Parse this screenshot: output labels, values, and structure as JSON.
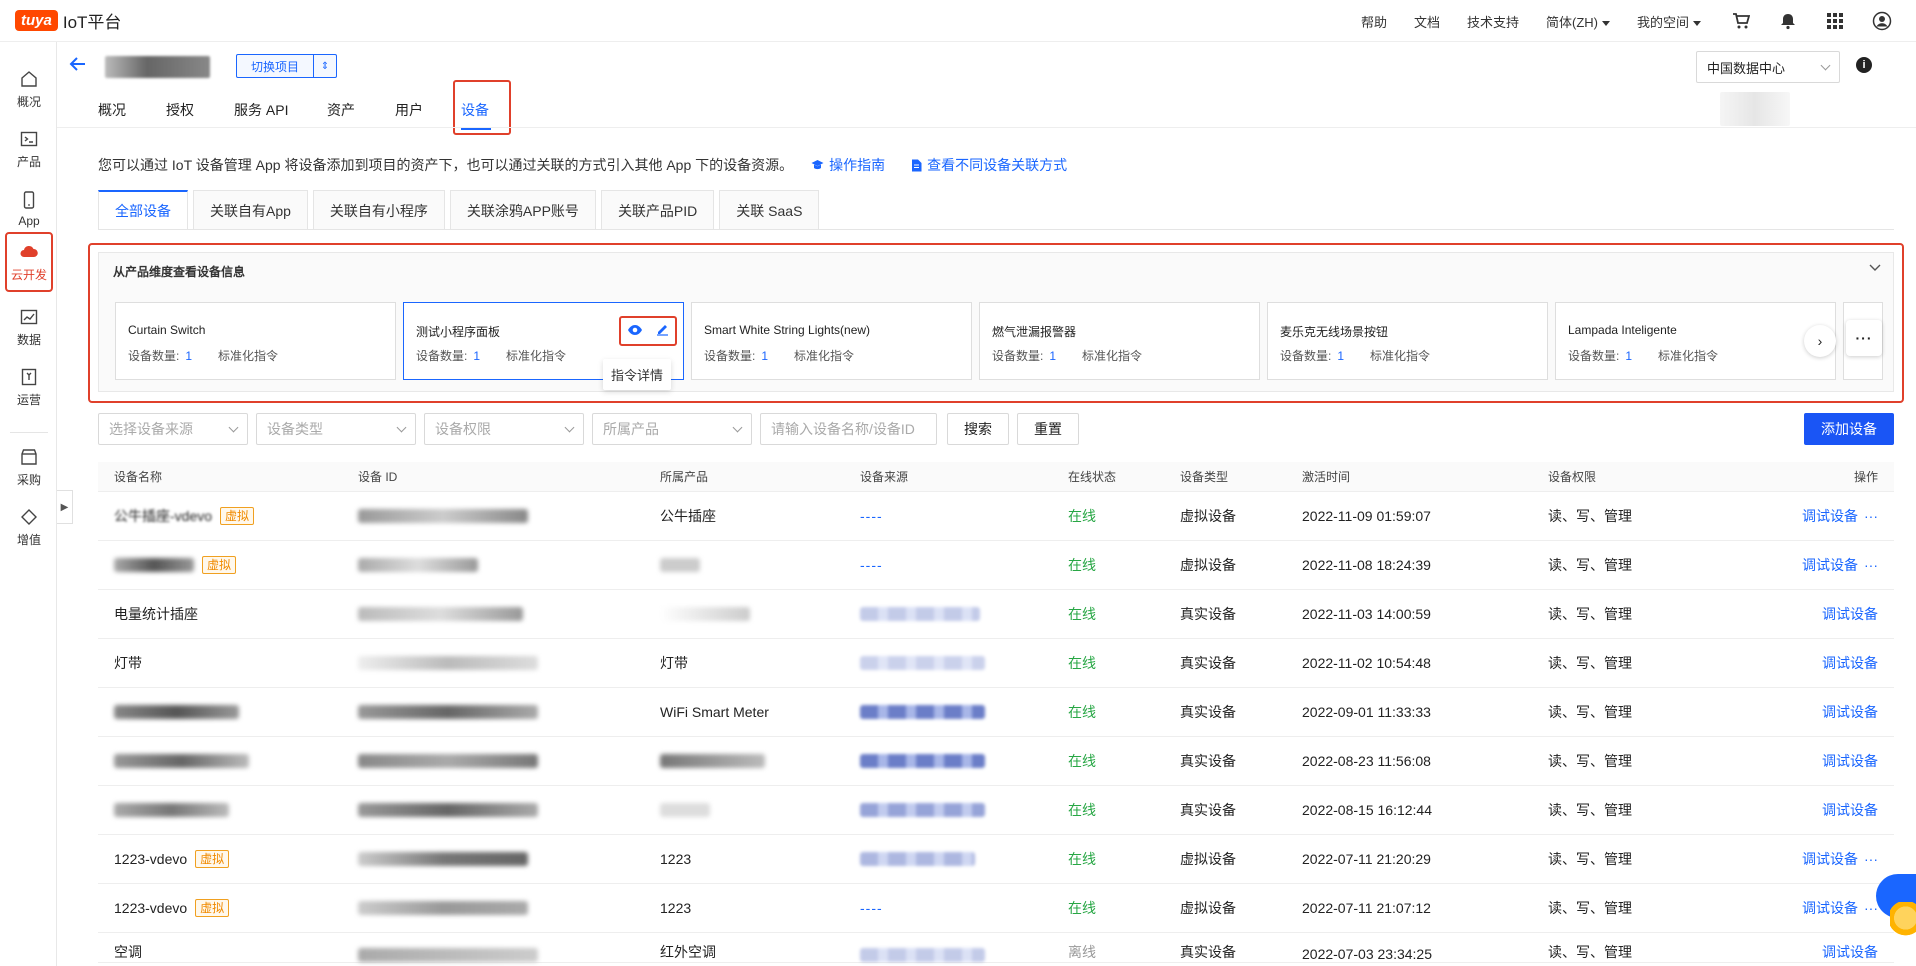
{
  "brand": {
    "logo": "tuya",
    "title": "IoT平台"
  },
  "topnav": {
    "help": "帮助",
    "docs": "文档",
    "support": "技术支持",
    "language": "简体(ZH)",
    "myspace": "我的空间",
    "icons": [
      "cart-icon",
      "bell-icon",
      "apps-grid-icon",
      "user-icon"
    ]
  },
  "sidebar": {
    "items": [
      {
        "label": "概况",
        "icon": "home-icon"
      },
      {
        "label": "产品",
        "icon": "terminal-icon"
      },
      {
        "label": "App",
        "icon": "phone-icon"
      },
      {
        "label": "云开发",
        "icon": "cloud-icon"
      },
      {
        "label": "数据",
        "icon": "chart-icon"
      },
      {
        "label": "运营",
        "icon": "bookmark-icon"
      },
      {
        "label": "采购",
        "icon": "store-icon"
      },
      {
        "label": "增值",
        "icon": "diamond-icon"
      }
    ]
  },
  "project": {
    "switch_label": "切换项目"
  },
  "tabs": [
    "概况",
    "授权",
    "服务 API",
    "资产",
    "用户",
    "设备"
  ],
  "region": {
    "selected": "中国数据中心"
  },
  "description": {
    "text": "您可以通过 IoT 设备管理 App 将设备添加到项目的资产下，也可以通过关联的方式引入其他 App 下的设备资源。",
    "link_guide": "操作指南",
    "link_methods": "查看不同设备关联方式"
  },
  "subtabs": [
    "全部设备",
    "关联自有App",
    "关联自有小程序",
    "关联涂鸦APP账号",
    "关联产品PID",
    "关联 SaaS"
  ],
  "product_panel": {
    "title": "从产品维度查看设备信息",
    "count_label": "设备数量:",
    "std_label": "标准化指令",
    "tooltip": "指令详情",
    "cards": [
      {
        "name": "Curtain Switch",
        "count": "1"
      },
      {
        "name": "测试小程序面板",
        "count": "1"
      },
      {
        "name": "Smart White String Lights(new)",
        "count": "1"
      },
      {
        "name": "燃气泄漏报警器",
        "count": "1"
      },
      {
        "name": "麦乐克无线场景按钮",
        "count": "1"
      },
      {
        "name": "Lampada Inteligente",
        "count": "1"
      }
    ]
  },
  "filters": {
    "source": "选择设备来源",
    "type": "设备类型",
    "permission": "设备权限",
    "product": "所属产品",
    "search_placeholder": "请输入设备名称/设备ID",
    "search_btn": "搜索",
    "reset_btn": "重置",
    "add_btn": "添加设备"
  },
  "table": {
    "headers": [
      "设备名称",
      "设备 ID",
      "所属产品",
      "设备来源",
      "在线状态",
      "设备类型",
      "激活时间",
      "设备权限",
      "操作"
    ],
    "virtual_tag": "虚拟",
    "action_label": "调试设备",
    "rows": [
      {
        "name": "公牛插座-vdevo",
        "product": "公牛插座",
        "source": "----",
        "status": "在线",
        "type": "虚拟设备",
        "time": "2022-11-09 01:59:07",
        "perm": "读、写、管理"
      },
      {
        "name": "",
        "product": "",
        "source": "----",
        "status": "在线",
        "type": "虚拟设备",
        "time": "2022-11-08 18:24:39",
        "perm": "读、写、管理"
      },
      {
        "name": "电量统计插座",
        "product": "",
        "source": "",
        "status": "在线",
        "type": "真实设备",
        "time": "2022-11-03 14:00:59",
        "perm": "读、写、管理"
      },
      {
        "name": "灯带",
        "product": "灯带",
        "source": "",
        "status": "在线",
        "type": "真实设备",
        "time": "2022-11-02 10:54:48",
        "perm": "读、写、管理"
      },
      {
        "name": "",
        "product": "WiFi Smart Meter",
        "source": "",
        "status": "在线",
        "type": "真实设备",
        "time": "2022-09-01 11:33:33",
        "perm": "读、写、管理"
      },
      {
        "name": "",
        "product": "",
        "source": "",
        "status": "在线",
        "type": "真实设备",
        "time": "2022-08-23 11:56:08",
        "perm": "读、写、管理"
      },
      {
        "name": "",
        "product": "",
        "source": "",
        "status": "在线",
        "type": "真实设备",
        "time": "2022-08-15 16:12:44",
        "perm": "读、写、管理"
      },
      {
        "name": "1223-vdevo",
        "product": "1223",
        "source": "",
        "status": "在线",
        "type": "虚拟设备",
        "time": "2022-07-11 21:20:29",
        "perm": "读、写、管理"
      },
      {
        "name": "1223-vdevo",
        "product": "1223",
        "source": "----",
        "status": "在线",
        "type": "虚拟设备",
        "time": "2022-07-11 21:07:12",
        "perm": "读、写、管理"
      },
      {
        "name": "空调",
        "product": "红外空调",
        "source": "",
        "status": "离线",
        "type": "真实设备",
        "time": "2022-07-03 23:34:25",
        "perm": "读、写、管理"
      }
    ]
  },
  "colors": {
    "accent": "#1a66ff",
    "highlight": "#e0402b",
    "online": "#28a745",
    "brand": "#ff4800"
  }
}
